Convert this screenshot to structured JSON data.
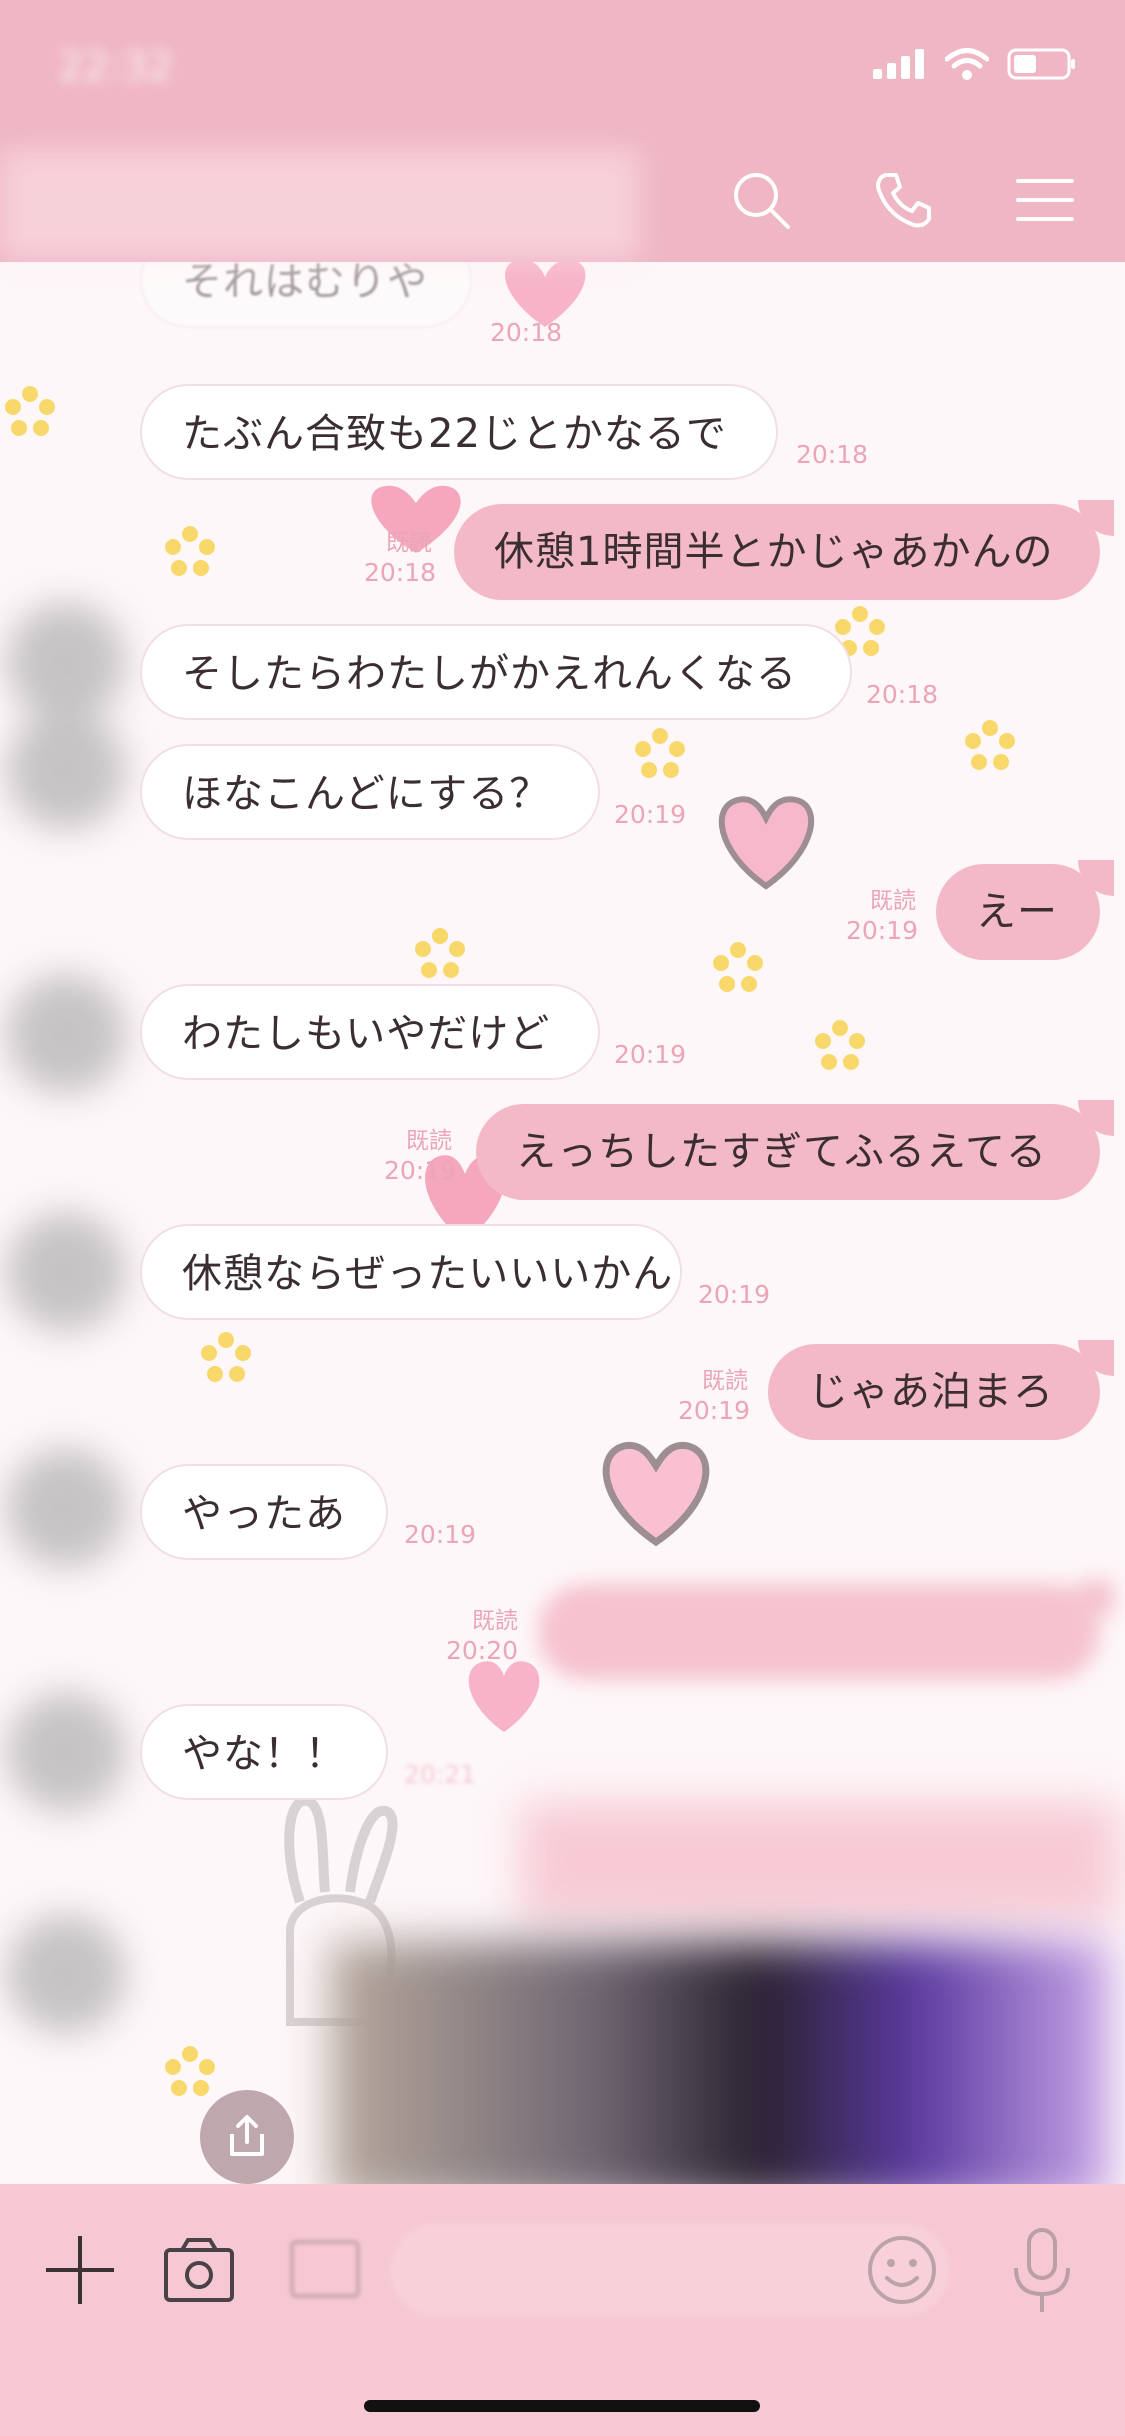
{
  "status_bar": {
    "time": "22:32"
  },
  "header": {
    "icons": [
      "search-icon",
      "phone-icon",
      "menu-icon"
    ]
  },
  "messages": [
    {
      "side": "in",
      "text": "それはむりや",
      "time": "20:18"
    },
    {
      "side": "in",
      "text": "たぶん合致も22じとかなるで",
      "time": "20:18"
    },
    {
      "side": "out",
      "text": "休憩1時間半とかじゃあかんの",
      "time": "20:18",
      "read": "既読"
    },
    {
      "side": "in",
      "text": "そしたらわたしがかえれんくなる",
      "time": "20:18"
    },
    {
      "side": "in",
      "text": "ほなこんどにする？",
      "time": "20:19"
    },
    {
      "side": "out",
      "text": "えー",
      "time": "20:19",
      "read": "既読"
    },
    {
      "side": "in",
      "text": "わたしもいやだけど",
      "time": "20:19"
    },
    {
      "side": "out",
      "text": "えっちしたすぎてふるえてる",
      "time": "20:19",
      "read": "既読"
    },
    {
      "side": "in",
      "text": "休憩ならぜったいいいかん",
      "time": "20:19"
    },
    {
      "side": "out",
      "text": "じゃあ泊まろ",
      "time": "20:19",
      "read": "既読"
    },
    {
      "side": "in",
      "text": "やったあ",
      "time": "20:19"
    },
    {
      "side": "out",
      "text": "",
      "time": "20:20",
      "read": "既読"
    },
    {
      "side": "in",
      "text": "やな！！",
      "time": "20:21"
    }
  ],
  "bottom_bar": {
    "icons": [
      "plus-icon",
      "camera-icon",
      "image-icon",
      "emoji-icon",
      "mic-icon"
    ]
  },
  "colors": {
    "header": "#efb6c4",
    "out_bubble": "#f4b9c7",
    "accent": "#eaa6b6"
  }
}
